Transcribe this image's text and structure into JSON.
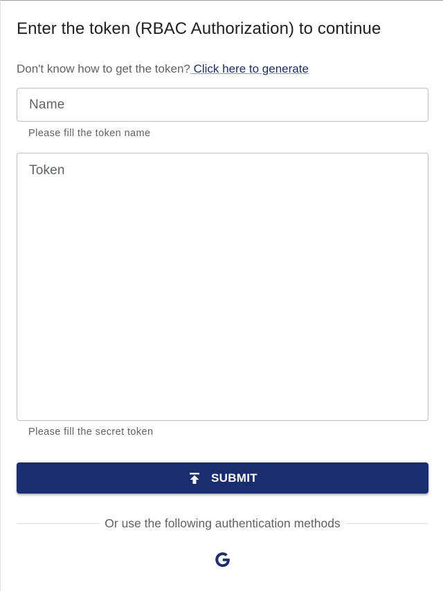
{
  "dialog": {
    "title": "Enter the token (RBAC Authorization) to continue",
    "help_text": "Don't know how to get the token?",
    "help_link": " Click here to generate"
  },
  "form": {
    "name_placeholder": "Name",
    "name_value": "",
    "name_helper": "Please fill the token name",
    "token_placeholder": "Token",
    "token_value": "",
    "token_helper": "Please fill the secret token",
    "submit_label": "SUBMIT",
    "submit_icon": "upload-icon"
  },
  "auth": {
    "divider_text": "Or use the following authentication methods",
    "methods": [
      {
        "icon": "google-icon"
      }
    ]
  },
  "colors": {
    "primary": "#1a2d6e",
    "text_primary": "#212121",
    "text_secondary": "#616161",
    "border": "#bdbdbd"
  }
}
